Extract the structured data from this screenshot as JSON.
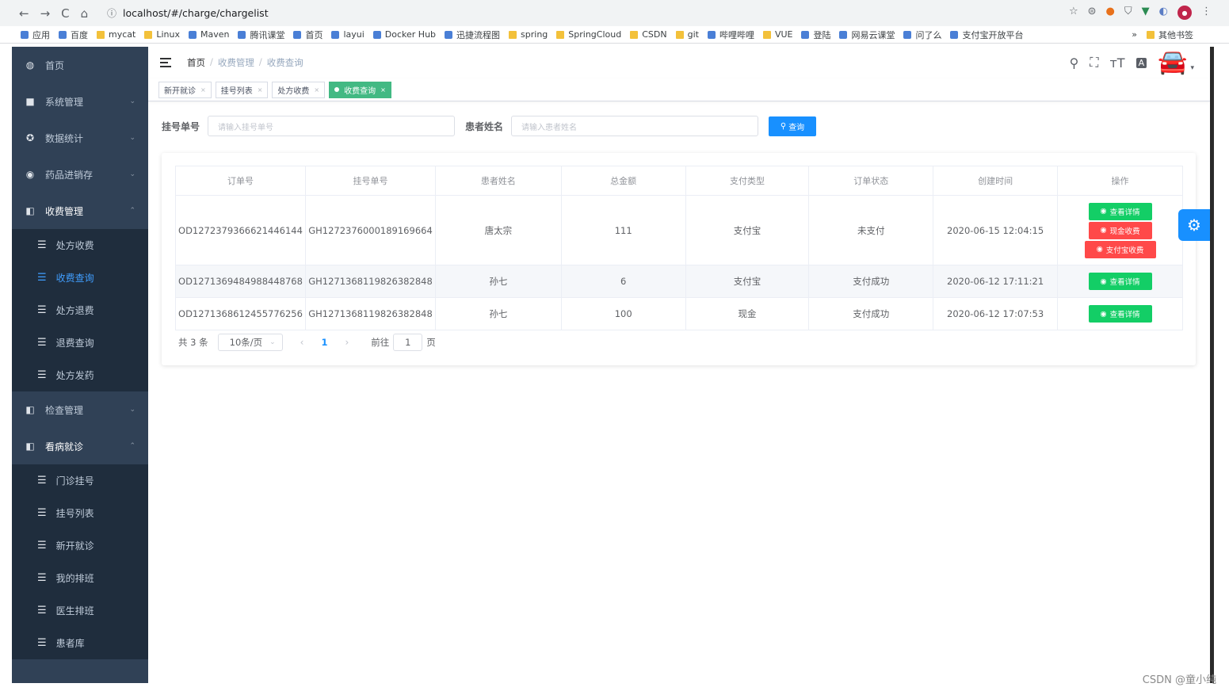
{
  "browser": {
    "nav": [
      "←",
      "→",
      "C",
      "⌂"
    ],
    "url": "localhost/#/charge/chargelist",
    "bookmarks": [
      "应用",
      "百度",
      "mycat",
      "Linux",
      "Maven",
      "腾讯课堂",
      "首页",
      "layui",
      "Docker Hub",
      "迅捷流程图",
      "spring",
      "SpringCloud",
      "CSDN",
      "git",
      "哔哩哔哩",
      "VUE",
      "登陆",
      "网易云课堂",
      "问了么",
      "支付宝开放平台"
    ],
    "bookmarks_more": "»",
    "other_bookmarks": "其他书签"
  },
  "sidebar": {
    "items": [
      {
        "label": "首页",
        "icon": "dashboard-icon",
        "glyph": "◍"
      },
      {
        "label": "系统管理",
        "icon": "lock-icon",
        "glyph": "■",
        "arrow": "⌄"
      },
      {
        "label": "数据统计",
        "icon": "stats-icon",
        "glyph": "✪",
        "arrow": "⌄"
      },
      {
        "label": "药品进销存",
        "icon": "eye-icon",
        "glyph": "◉",
        "arrow": "⌄"
      }
    ],
    "charge_group": {
      "label": "收费管理",
      "glyph": "◧",
      "arrow": "⌃",
      "children": [
        "处方收费",
        "收费查询",
        "处方退费",
        "退费查询",
        "处方发药"
      ],
      "active": "收费查询"
    },
    "inspect_group": {
      "label": "检查管理",
      "glyph": "◧",
      "arrow": "⌄"
    },
    "visit_group": {
      "label": "看病就诊",
      "glyph": "◧",
      "arrow": "⌃",
      "children": [
        "门诊挂号",
        "挂号列表",
        "新开就诊",
        "我的排班",
        "医生排班",
        "患者库"
      ]
    }
  },
  "header": {
    "breadcrumb": [
      "首页",
      "收费管理",
      "收费查询"
    ],
    "tools": [
      "⚲",
      "⛶",
      "ᴛT",
      "A"
    ]
  },
  "tags": [
    {
      "label": "新开就诊",
      "active": false
    },
    {
      "label": "挂号列表",
      "active": false
    },
    {
      "label": "处方收费",
      "active": false
    },
    {
      "label": "收费查询",
      "active": true
    }
  ],
  "search": {
    "reg_label": "挂号单号",
    "reg_placeholder": "请输入挂号单号",
    "name_label": "患者姓名",
    "name_placeholder": "请输入患者姓名",
    "button": "查询"
  },
  "table": {
    "headers": [
      "订单号",
      "挂号单号",
      "患者姓名",
      "总金额",
      "支付类型",
      "订单状态",
      "创建时间",
      "操作"
    ],
    "rows": [
      {
        "order": "OD1272379366621446144",
        "reg": "GH1272376000189169664",
        "name": "唐太宗",
        "amount": "111",
        "pay": "支付宝",
        "status": "未支付",
        "time": "2020-06-15 12:04:15"
      },
      {
        "order": "OD1271369484988448768",
        "reg": "GH1271368119826382848",
        "name": "孙七",
        "amount": "6",
        "pay": "支付宝",
        "status": "支付成功",
        "time": "2020-06-12 17:11:21"
      },
      {
        "order": "OD1271368612455776256",
        "reg": "GH1271368119826382848",
        "name": "孙七",
        "amount": "100",
        "pay": "现金",
        "status": "支付成功",
        "time": "2020-06-12 17:07:53"
      }
    ],
    "btn_detail": "查看详情",
    "btn_cash": "现金收费",
    "btn_alipay": "支付宝收费"
  },
  "pagination": {
    "total": "共 3 条",
    "page_size": "10条/页",
    "current": "1",
    "goto": "前往",
    "goto_value": "1",
    "page_unit": "页"
  },
  "watermark": "CSDN @童小纯"
}
